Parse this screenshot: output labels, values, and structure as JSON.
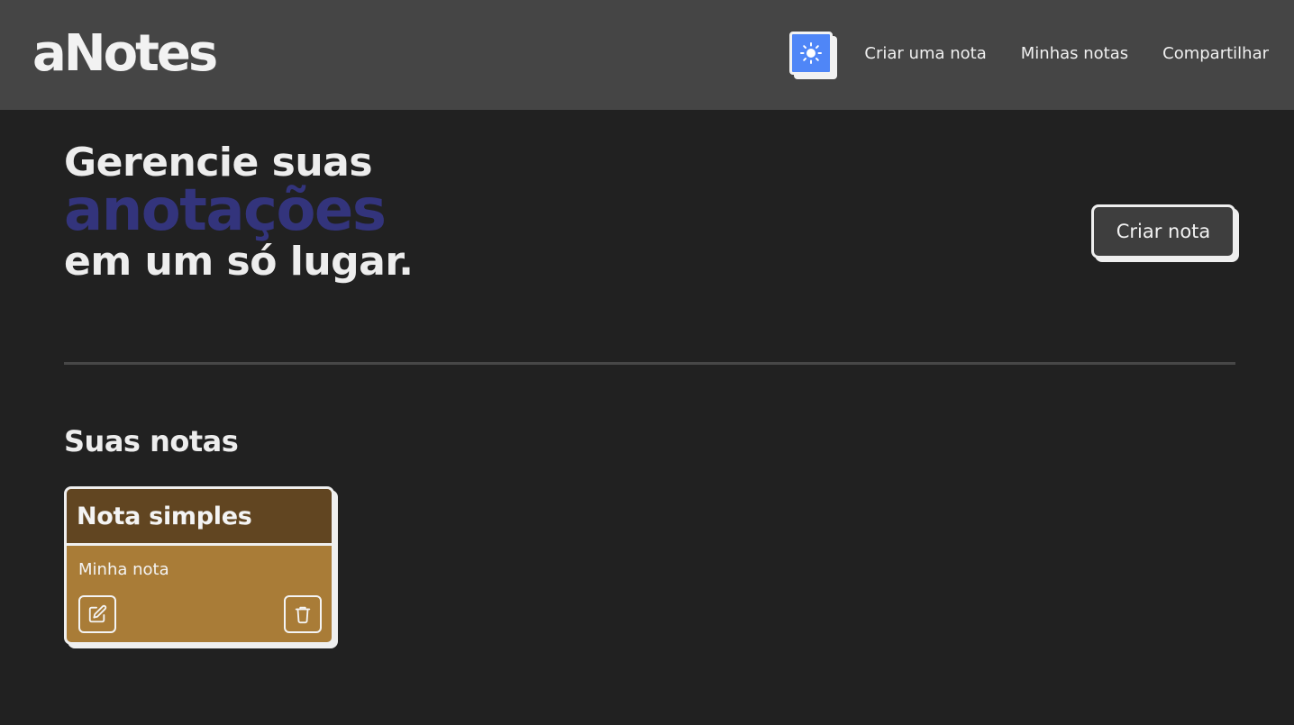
{
  "header": {
    "logo": "aNotes",
    "theme_toggle_icon": "sun-icon",
    "nav": [
      {
        "label": "Criar uma nota"
      },
      {
        "label": "Minhas notas"
      },
      {
        "label": "Compartilhar"
      }
    ]
  },
  "hero": {
    "line1": "Gerencie suas",
    "accent": "anotações",
    "line3": "em um só lugar.",
    "cta_label": "Criar nota"
  },
  "notes_section": {
    "title": "Suas notas",
    "notes": [
      {
        "title": "Nota simples",
        "body": "Minha nota",
        "edit_icon": "edit-icon",
        "delete_icon": "trash-icon"
      }
    ]
  },
  "colors": {
    "background": "#212121",
    "header": "#454545",
    "accent_text": "#33347c",
    "toggle": "#4f86f7",
    "note_header": "#614521",
    "note_body": "#a97c37"
  }
}
